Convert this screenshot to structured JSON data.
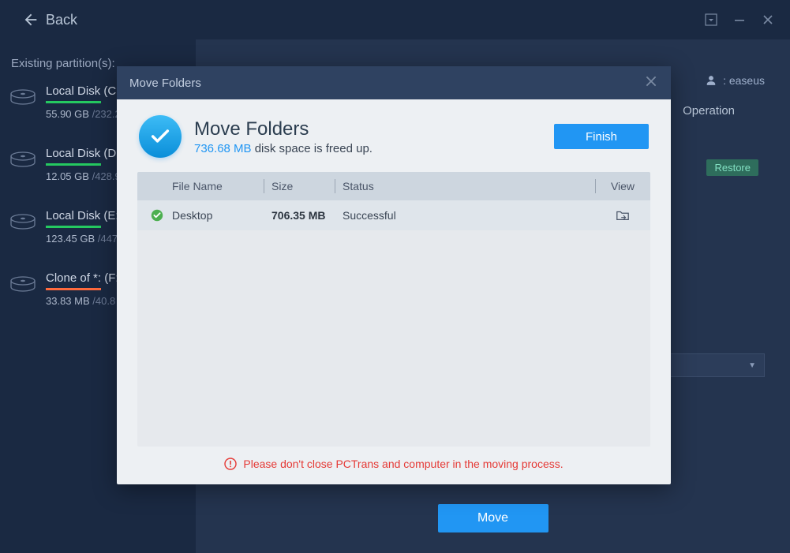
{
  "titlebar": {
    "back_label": "Back"
  },
  "sidebar": {
    "title": "Existing partition(s):",
    "partitions": [
      {
        "name": "Local Disk (C:)",
        "used": "55.90 GB",
        "total": "232.2",
        "bar": "green"
      },
      {
        "name": "Local Disk (D:)",
        "used": "12.05 GB",
        "total": "428.9",
        "bar": "green"
      },
      {
        "name": "Local Disk (E:)",
        "used": "123.45 GB",
        "total": "447",
        "bar": "green"
      },
      {
        "name": "Clone of *: (F:)",
        "used": "33.83 MB",
        "total": "40.8",
        "bar": "orange"
      }
    ]
  },
  "content": {
    "user": "easeus",
    "operation_header": "Operation",
    "restore_label": "Restore",
    "move_label": "Move"
  },
  "modal": {
    "title": "Move Folders",
    "header_title": "Move Folders",
    "freed_amount": "736.68 MB",
    "freed_text": " disk space is freed up.",
    "finish_label": "Finish",
    "columns": {
      "name": "File Name",
      "size": "Size",
      "status": "Status",
      "view": "View"
    },
    "rows": [
      {
        "name": "Desktop",
        "size": "706.35 MB",
        "status": "Successful"
      }
    ],
    "warning": "Please don't close PCTrans and computer in the moving process."
  }
}
